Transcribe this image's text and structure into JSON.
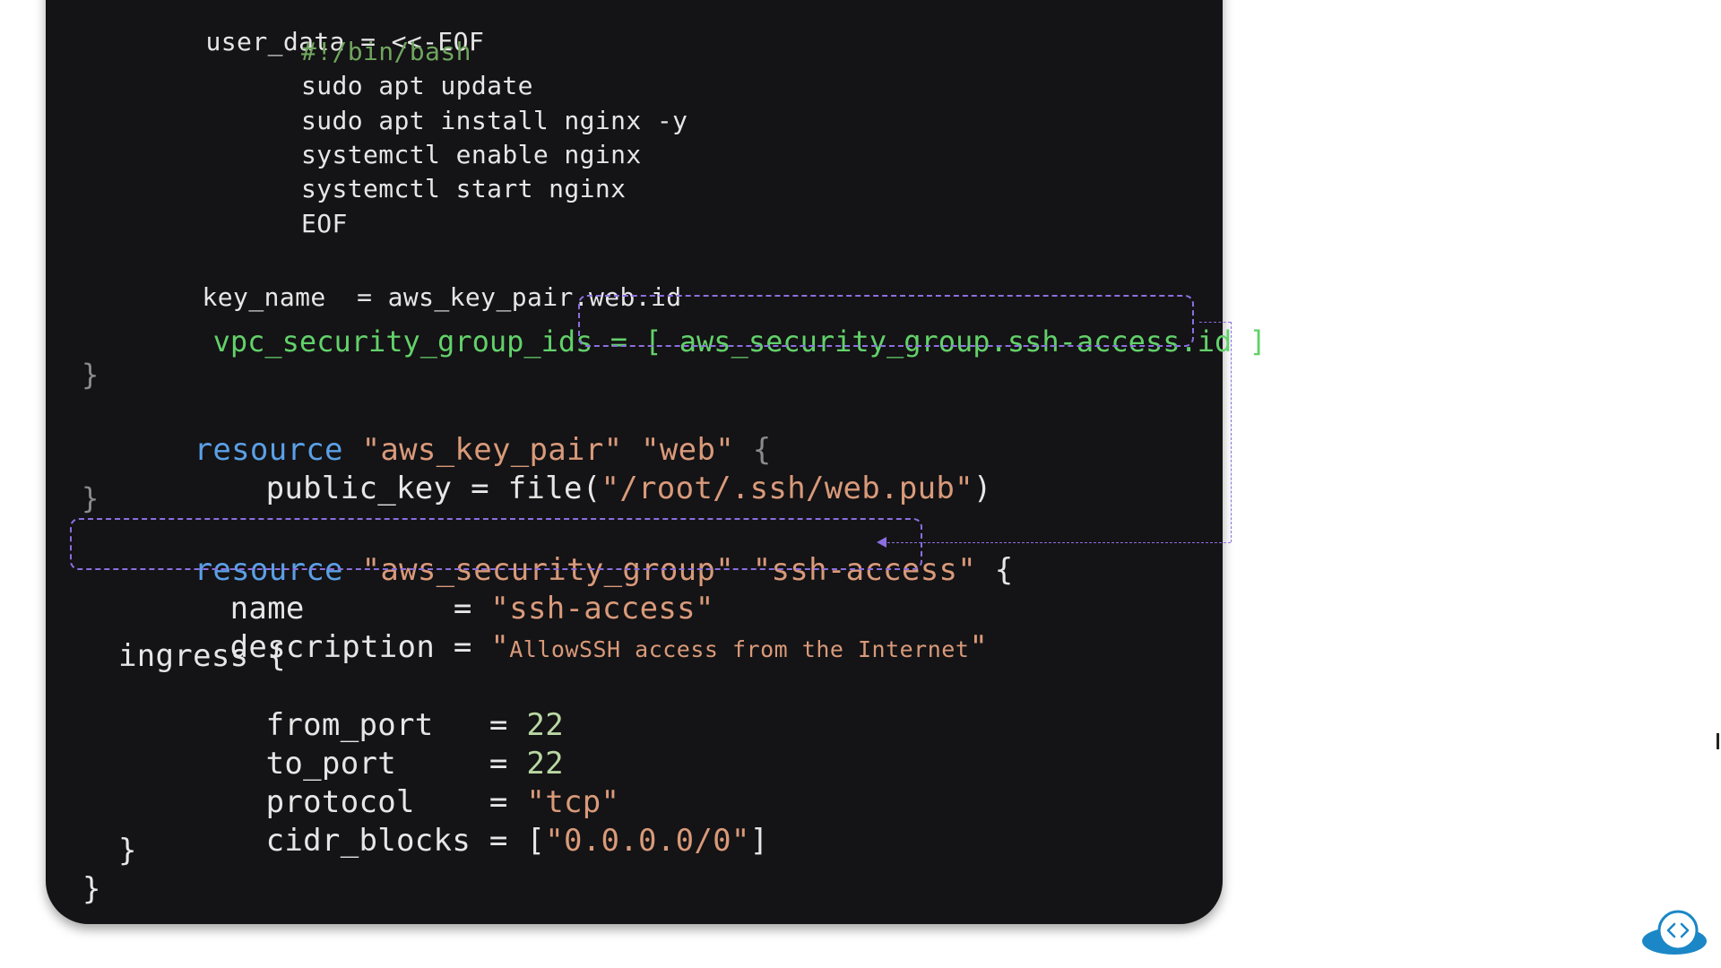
{
  "code": {
    "user_data_line": {
      "key": "user_data",
      "op": " = ",
      "heredoc": "<<-EOF"
    },
    "shebang": "#!/bin/bash",
    "script_lines": [
      "sudo apt update",
      "sudo apt install nginx -y",
      "systemctl enable nginx",
      "systemctl start nginx",
      "EOF"
    ],
    "key_name_line": {
      "key": "key_name",
      "op": "  = ",
      "value": "aws_key_pair.web.id"
    },
    "vpc_line": {
      "key": "vpc_security_group_ids",
      "op": " = [ ",
      "value": "aws_security_group.ssh-access.id",
      "close": " ]"
    },
    "close_brace_1": "}",
    "key_pair_resource": {
      "keyword": "resource",
      "type": "\"aws_key_pair\"",
      "name": "\"web\"",
      "open": "{"
    },
    "public_key_line": {
      "key": "public_key",
      "op": " = file(",
      "value": "\"/root/.ssh/web.pub\"",
      "close": ")"
    },
    "close_brace_2": "}",
    "sg_resource": {
      "keyword": "resource",
      "type": "\"aws_security_group\"",
      "name": "\"ssh-access\"",
      "open": "{"
    },
    "sg_name_line": {
      "key": "name",
      "op": "        = ",
      "value": "\"ssh-access\""
    },
    "sg_description_line": {
      "key": "description",
      "op": " = ",
      "quote_open": "\"",
      "value": "AllowSSH access from the Internet",
      "quote_close": "\""
    },
    "ingress_open": "ingress {",
    "from_port_line": {
      "key": "from_port",
      "op": "   = ",
      "value": "22"
    },
    "to_port_line": {
      "key": "to_port",
      "op": "     = ",
      "value": "22"
    },
    "protocol_line": {
      "key": "protocol",
      "op": "    = ",
      "value": "\"tcp\""
    },
    "cidr_line": {
      "key": "cidr_blocks",
      "op": " = [",
      "value": "\"0.0.0.0/0\"",
      "close": "]"
    },
    "ingress_close": "}",
    "final_close": "}"
  },
  "colors": {
    "panel_bg": "#141315",
    "keyword": "#5aa0e6",
    "string": "#d99a7a",
    "comment": "#6fa65f",
    "highlight_green": "#62d16a",
    "annotation": "#8b6fe0"
  },
  "icons": {
    "logo": "code-cloud-icon"
  }
}
